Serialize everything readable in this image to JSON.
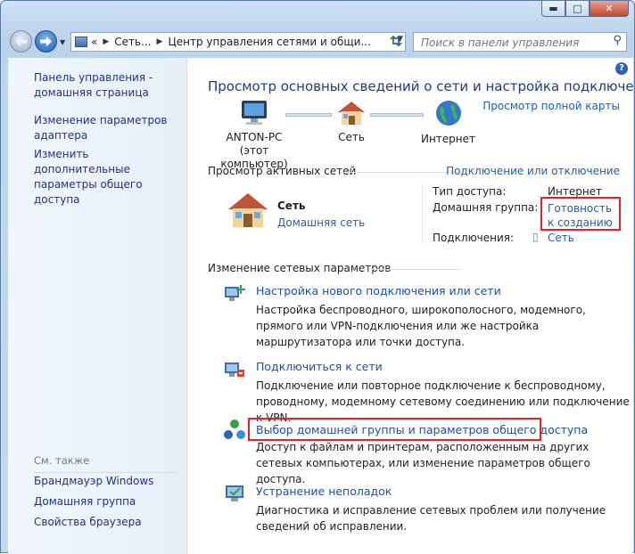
{
  "window": {
    "minimize": "▬",
    "maximize": "□",
    "close": "✕"
  },
  "nav": {
    "address_root": "«",
    "address_part1": "Сеть...",
    "address_part2": "Центр управления сетями и общи...",
    "search_placeholder": "Поиск в панели управления"
  },
  "sidebar": {
    "items": [
      {
        "label": "Панель управления - домашняя страница"
      },
      {
        "label": "Изменение параметров адаптера"
      },
      {
        "label": "Изменить дополнительные параметры общего доступа"
      }
    ],
    "see_also_title": "См. также",
    "see_also": [
      {
        "label": "Брандмауэр Windows"
      },
      {
        "label": "Домашняя группа"
      },
      {
        "label": "Свойства браузера"
      }
    ]
  },
  "main": {
    "title": "Просмотр основных сведений о сети и настройка подключений",
    "full_map_link": "Просмотр полной карты",
    "map": {
      "computer_name": "ANTON-PC",
      "computer_sub": "(этот компьютер)",
      "network": "Сеть",
      "internet": "Интернет"
    },
    "active_networks_title": "Просмотр активных сетей",
    "connect_disconnect": "Подключение или отключение",
    "active_network": {
      "name": "Сеть",
      "type_link": "Домашняя сеть",
      "access_label": "Тип доступа:",
      "access_value": "Интернет",
      "homegroup_label": "Домашняя группа:",
      "homegroup_value": "Готовность к созданию",
      "connections_label": "Подключения:",
      "connections_value": "Сеть"
    },
    "change_settings_title": "Изменение сетевых параметров",
    "tasks": [
      {
        "title": "Настройка нового подключения или сети",
        "desc": "Настройка беспроводного, широкополосного, модемного, прямого или VPN-подключения или же настройка маршрутизатора или точки доступа."
      },
      {
        "title": "Подключиться к сети",
        "desc": "Подключение или повторное подключение к беспроводному, проводному, модемному сетевому соединению или подключение к VPN."
      },
      {
        "title": "Выбор домашней группы и параметров общего доступа",
        "desc": "Доступ к файлам и принтерам, расположенным на других сетевых компьютерах, или изменение параметров общего доступа."
      },
      {
        "title": "Устранение неполадок",
        "desc": "Диагностика и исправление сетевых проблем или получение сведений об исправлении."
      }
    ]
  },
  "colors": {
    "link": "#1e5fa8",
    "title": "#1a3e84",
    "highlight_box": "#e0242b"
  }
}
